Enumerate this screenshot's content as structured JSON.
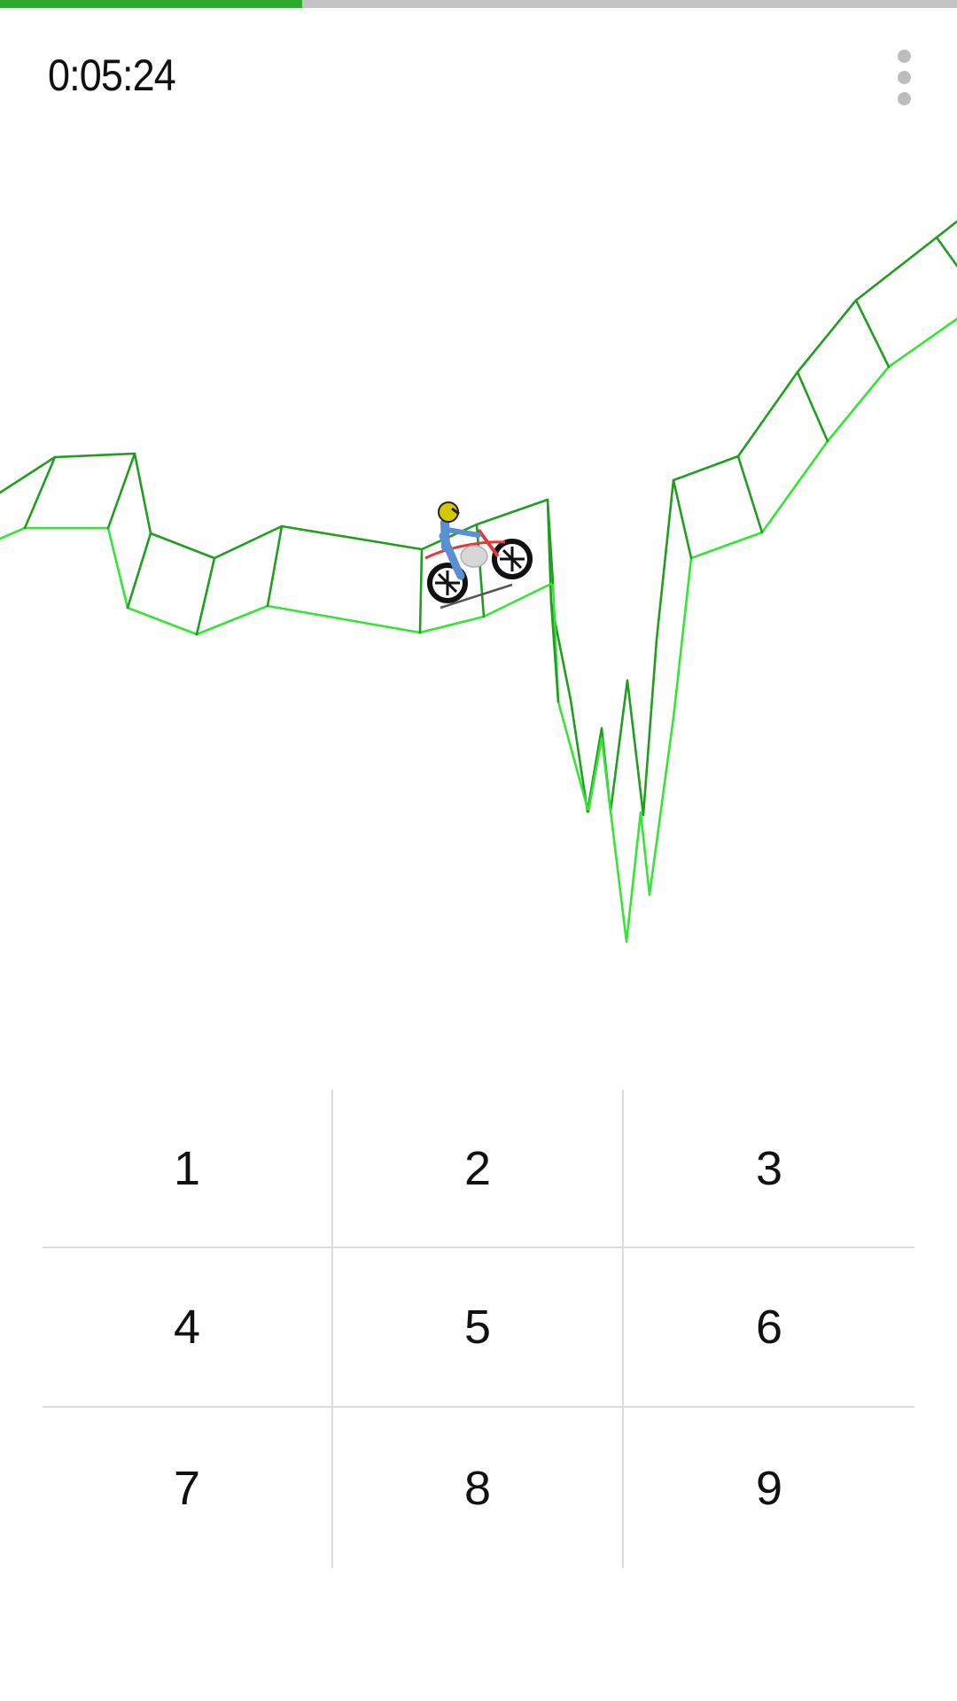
{
  "progress": {
    "fraction": 0.316,
    "fill_color": "#2eab2e",
    "track_color": "#c4c4c4"
  },
  "timer": {
    "text": "0:05:24"
  },
  "menu": {
    "icon": "more-vert-icon"
  },
  "track": {
    "dark_color": "#1f9e1f",
    "light_color": "#33e633"
  },
  "keypad": {
    "keys": [
      "1",
      "2",
      "3",
      "4",
      "5",
      "6",
      "7",
      "8",
      "9"
    ]
  }
}
